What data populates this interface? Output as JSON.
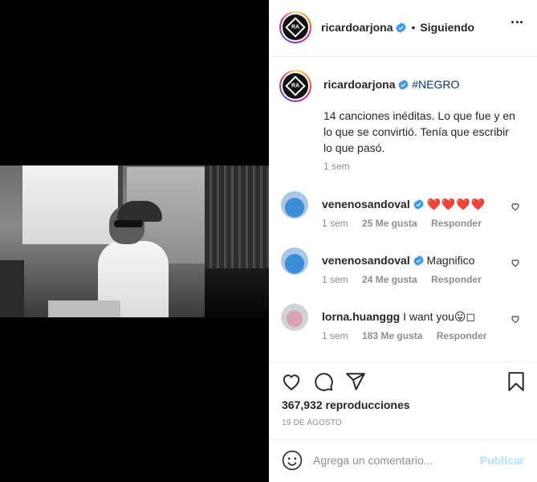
{
  "header": {
    "username": "ricardoarjona",
    "separator": "•",
    "follow_status": "Siguiendo",
    "avatar_text": "RA"
  },
  "caption": {
    "username": "ricardoarjona",
    "hashtag": "#NEGRO",
    "text": "14 canciones inéditas. Lo que fue y en lo que se convirtió. Tenía que escribir lo que pasó.",
    "time": "1 sem"
  },
  "comments": [
    {
      "username": "venenosandoval",
      "text": "❤️❤️❤️❤️",
      "time": "1 sem",
      "likes": "25 Me gusta",
      "reply": "Responder"
    },
    {
      "username": "venenosandoval",
      "text": "Magnifico",
      "time": "1 sem",
      "likes": "24 Me gusta",
      "reply": "Responder"
    },
    {
      "username": "lorna.huanggg",
      "text": "I want you😛◻",
      "time": "1 sem",
      "likes": "183 Me gusta",
      "reply": "Responder"
    }
  ],
  "stats": {
    "views": "367,932 reproducciones",
    "date": "19 DE AGOSTO"
  },
  "comment_box": {
    "placeholder": "Agrega un comentario...",
    "publish": "Publicar"
  },
  "colors": {
    "verified": "#3897f0",
    "link": "#00376b",
    "muted": "#8e8e8e",
    "publish_disabled": "#b2dffc"
  },
  "icons": [
    "heart-icon",
    "comment-icon",
    "share-icon",
    "bookmark-icon",
    "more-icon",
    "emoji-icon",
    "verified-icon"
  ]
}
